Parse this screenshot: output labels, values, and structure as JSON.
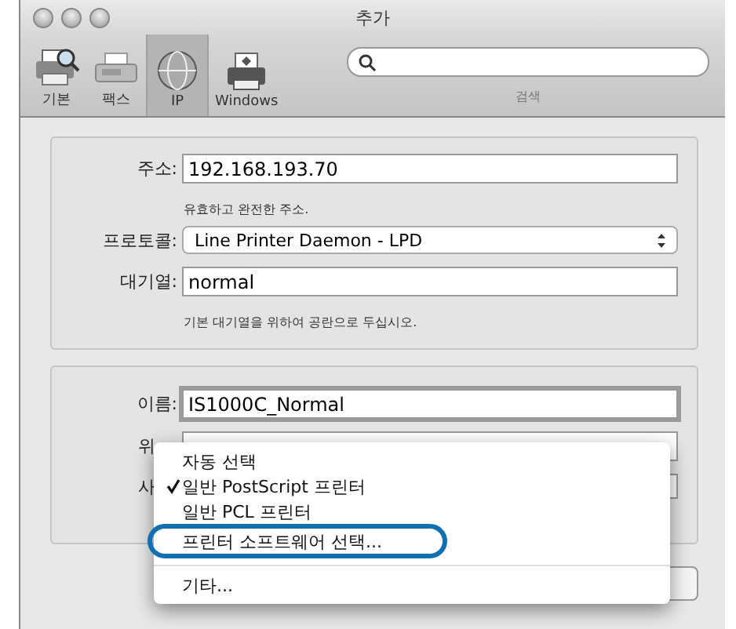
{
  "window": {
    "title": "추가"
  },
  "toolbar": [
    {
      "label": "기본",
      "kind": "printer-search",
      "selected": false
    },
    {
      "label": "팩스",
      "kind": "fax",
      "selected": false
    },
    {
      "label": "IP",
      "kind": "globe",
      "selected": true
    },
    {
      "label": "Windows",
      "kind": "printer",
      "selected": false
    }
  ],
  "search": {
    "label": "검색"
  },
  "connection": {
    "address": {
      "label": "주소:",
      "value": "192.168.193.70",
      "hint": "유효하고 완전한 주소."
    },
    "protocol": {
      "label": "프로토콜:",
      "value": "Line Printer Daemon - LPD"
    },
    "queue": {
      "label": "대기열:",
      "value": "normal",
      "hint": "기본 대기열을 위하여 공란으로 두십시오."
    }
  },
  "printer": {
    "name": {
      "label": "이름:",
      "value": "IS1000C_Normal"
    },
    "location": {
      "label": "위"
    },
    "use": {
      "label": "사"
    }
  },
  "driver_menu": [
    {
      "label": "자동 선택",
      "checked": false,
      "circled": false,
      "separator_before": false
    },
    {
      "label": "일반 PostScript 프린터",
      "checked": true,
      "circled": false,
      "separator_before": false
    },
    {
      "label": "일반 PCL 프린터",
      "checked": false,
      "circled": false,
      "separator_before": false
    },
    {
      "label": "프린터 소프트웨어 선택...",
      "checked": false,
      "circled": true,
      "separator_before": false
    },
    {
      "label": "기타...",
      "checked": false,
      "circled": false,
      "separator_before": true
    }
  ]
}
